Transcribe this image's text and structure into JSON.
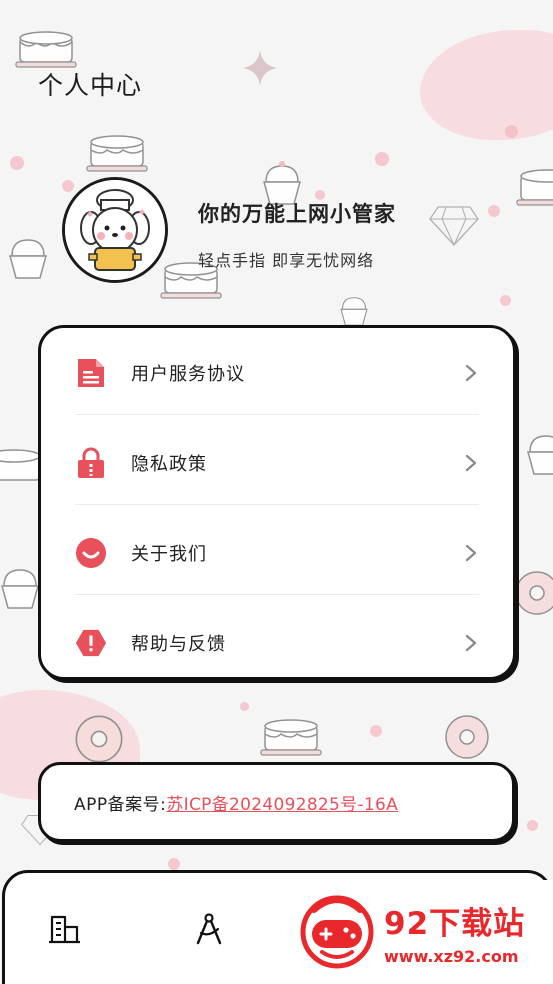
{
  "header": {
    "title": "个人中心"
  },
  "profile": {
    "name": "你的万能上网小管家",
    "subtitle": "轻点手指 即享无忧网络"
  },
  "menu": {
    "items": [
      {
        "label": "用户服务协议",
        "icon": "document-icon"
      },
      {
        "label": "隐私政策",
        "icon": "lock-icon"
      },
      {
        "label": "关于我们",
        "icon": "smile-icon"
      },
      {
        "label": "帮助与反馈",
        "icon": "warning-icon"
      }
    ]
  },
  "icp": {
    "label": "APP备案号:",
    "value": "苏ICP备2024092825号-16A"
  },
  "tabbar": {
    "tabs": [
      {
        "icon": "building-icon"
      },
      {
        "icon": "compass-icon"
      }
    ]
  },
  "watermark": {
    "brand": "92下载站",
    "url": "www.xz92.com"
  },
  "colors": {
    "accent": "#e8505b",
    "border": "#111111",
    "background": "#f6f5f5",
    "watermark": "#e8282b"
  }
}
